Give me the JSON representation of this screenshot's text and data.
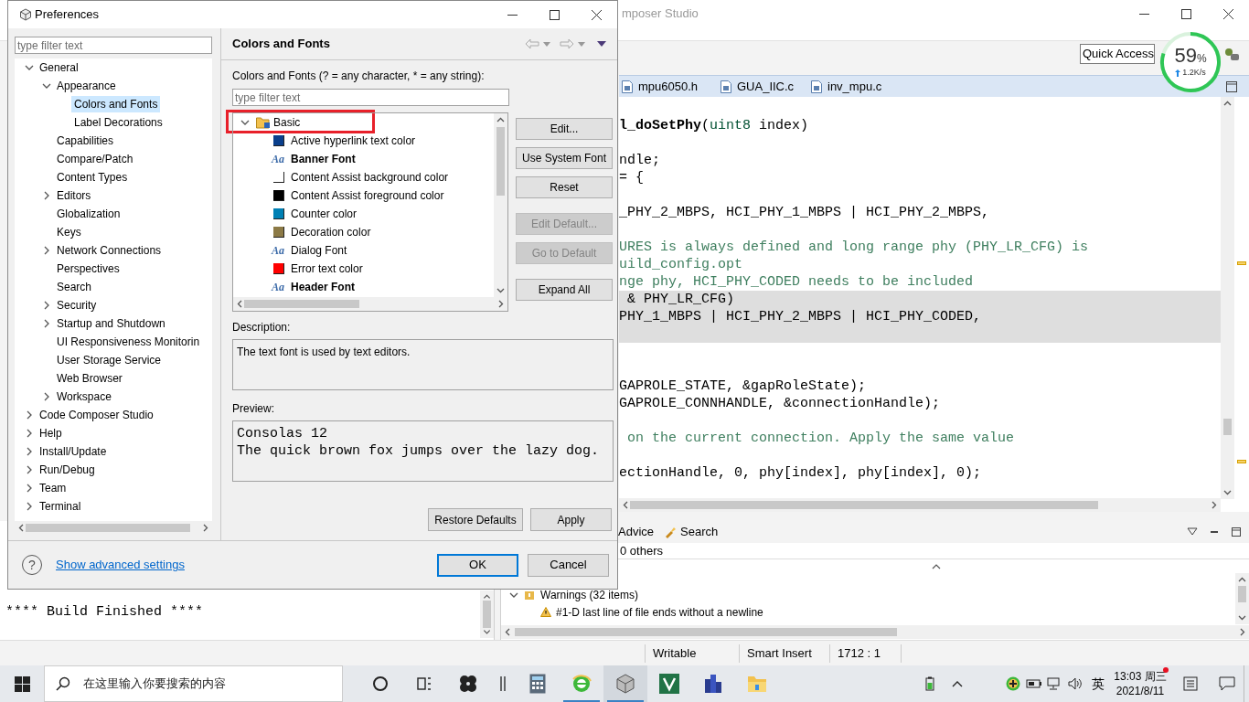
{
  "ide": {
    "title": "mposer Studio",
    "quick_access": "Quick Access",
    "meter": {
      "percent": "59",
      "unit": "%",
      "rate": "1.2K/s"
    },
    "editor_tabs": [
      {
        "label": "mpu6050.h"
      },
      {
        "label": "GUA_IIC.c"
      },
      {
        "label": "inv_mpu.c"
      }
    ],
    "code_lines": [
      {
        "highlighted": false,
        "segments": [
          {
            "kind": "bold",
            "text": "l_doSetPhy"
          },
          {
            "kind": "plain",
            "text": "("
          },
          {
            "kind": "type",
            "text": "uint8"
          },
          {
            "kind": "plain",
            "text": " index)"
          }
        ]
      },
      {
        "highlighted": false
      },
      {
        "highlighted": false,
        "segments": [
          {
            "kind": "plain",
            "text": "ndle;"
          }
        ]
      },
      {
        "highlighted": false,
        "segments": [
          {
            "kind": "plain",
            "text": "= {"
          }
        ]
      },
      {
        "highlighted": false
      },
      {
        "highlighted": false,
        "segments": [
          {
            "kind": "plain",
            "text": "_PHY_2_MBPS, HCI_PHY_1_MBPS | HCI_PHY_2_MBPS,"
          }
        ]
      },
      {
        "highlighted": false
      },
      {
        "highlighted": false,
        "segments": [
          {
            "kind": "comment",
            "text": "URES is always defined and long range phy (PHY_LR_CFG) is"
          }
        ]
      },
      {
        "highlighted": false,
        "segments": [
          {
            "kind": "comment",
            "text": "uild_config.opt"
          }
        ]
      },
      {
        "highlighted": false,
        "segments": [
          {
            "kind": "comment",
            "text": "nge phy, HCI_PHY_CODED needs to be included"
          }
        ]
      },
      {
        "highlighted": true,
        "segments": [
          {
            "kind": "plain",
            "text": " & PHY_LR_CFG)"
          }
        ]
      },
      {
        "highlighted": true,
        "segments": [
          {
            "kind": "plain",
            "text": "PHY_1_MBPS | HCI_PHY_2_MBPS | HCI_PHY_CODED,"
          }
        ]
      },
      {
        "highlighted": true
      },
      {
        "highlighted": false
      },
      {
        "highlighted": false
      },
      {
        "highlighted": false,
        "segments": [
          {
            "kind": "plain",
            "text": "GAPROLE_STATE, &gapRoleState);"
          }
        ]
      },
      {
        "highlighted": false,
        "segments": [
          {
            "kind": "plain",
            "text": "GAPROLE_CONNHANDLE, &connectionHandle);"
          }
        ]
      },
      {
        "highlighted": false
      },
      {
        "highlighted": false,
        "segments": [
          {
            "kind": "comment",
            "text": " on the current connection. Apply the same value"
          }
        ]
      },
      {
        "highlighted": false
      },
      {
        "highlighted": false,
        "segments": [
          {
            "kind": "plain",
            "text": "ectionHandle, 0, phy[index], phy[index], 0);"
          }
        ]
      }
    ],
    "console": {
      "text": "**** Build Finished ****"
    },
    "problems": {
      "tabs": [
        {
          "label": "Advice"
        },
        {
          "label": "Search"
        }
      ],
      "summary": "0 others",
      "groups": [
        {
          "label": "Warnings (32 items)",
          "expanded": true,
          "children": [
            {
              "label": "#1-D last line of file ends without a newline"
            }
          ]
        }
      ]
    },
    "status_bar": [
      "Writable",
      "Smart Insert",
      "1712 : 1"
    ]
  },
  "dialog": {
    "title": "Preferences",
    "filter_placeholder": "type filter text",
    "tree": [
      {
        "label": "General",
        "expanded": true,
        "selected": false,
        "children": [
          {
            "label": "Appearance",
            "expanded": true,
            "selected": false,
            "children": [
              {
                "label": "Colors and Fonts",
                "selected": true
              },
              {
                "label": "Label Decorations",
                "selected": false
              }
            ]
          },
          {
            "label": "Capabilities",
            "selected": false
          },
          {
            "label": "Compare/Patch",
            "selected": false
          },
          {
            "label": "Content Types",
            "selected": false
          },
          {
            "label": "Editors",
            "expanded": false,
            "selected": false
          },
          {
            "label": "Globalization",
            "selected": false
          },
          {
            "label": "Keys",
            "selected": false
          },
          {
            "label": "Network Connections",
            "expanded": false,
            "selected": false
          },
          {
            "label": "Perspectives",
            "selected": false
          },
          {
            "label": "Search",
            "selected": false
          },
          {
            "label": "Security",
            "expanded": false,
            "selected": false
          },
          {
            "label": "Startup and Shutdown",
            "expanded": false,
            "selected": false
          },
          {
            "label": "UI Responsiveness Monitorin",
            "selected": false
          },
          {
            "label": "User Storage Service",
            "selected": false
          },
          {
            "label": "Web Browser",
            "selected": false
          },
          {
            "label": "Workspace",
            "expanded": false,
            "selected": false
          }
        ]
      },
      {
        "label": "Code Composer Studio",
        "expanded": false,
        "selected": false
      },
      {
        "label": "Help",
        "expanded": false,
        "selected": false
      },
      {
        "label": "Install/Update",
        "expanded": false,
        "selected": false
      },
      {
        "label": "Run/Debug",
        "expanded": false,
        "selected": false
      },
      {
        "label": "Team",
        "expanded": false,
        "selected": false
      },
      {
        "label": "Terminal",
        "expanded": false,
        "selected": false
      }
    ],
    "page_title": "Colors and Fonts",
    "filter_label": "Colors and Fonts (? = any character, * = any string):",
    "page_filter_placeholder": "type filter text",
    "items": [
      {
        "label": "Basic",
        "expanded": true,
        "highlighted": true,
        "children": [
          {
            "kind": "color",
            "label": "Active hyperlink text color",
            "color": "#0a3f8c"
          },
          {
            "kind": "font",
            "label": "Banner Font",
            "icon": "Aa",
            "bold": true
          },
          {
            "kind": "color",
            "label": "Content Assist background color",
            "color": "#ffffff"
          },
          {
            "kind": "color",
            "label": "Content Assist foreground color",
            "color": "#000000"
          },
          {
            "kind": "color",
            "label": "Counter color",
            "color": "#0080b4"
          },
          {
            "kind": "color",
            "label": "Decoration color",
            "color": "#8c7a46"
          },
          {
            "kind": "font",
            "label": "Dialog Font",
            "icon": "Aa",
            "bold": false
          },
          {
            "kind": "color",
            "label": "Error text color",
            "color": "#ff0000"
          },
          {
            "kind": "font",
            "label": "Header Font",
            "icon": "Aa",
            "bold": true
          }
        ]
      }
    ],
    "side_buttons": [
      [
        {
          "label": "Edit...",
          "disabled": false
        },
        {
          "label": "Use System Font",
          "disabled": false
        },
        {
          "label": "Reset",
          "disabled": false
        }
      ],
      [
        {
          "label": "Edit Default...",
          "disabled": true
        },
        {
          "label": "Go to Default",
          "disabled": true
        }
      ],
      [
        {
          "label": "Expand All",
          "disabled": false
        }
      ]
    ],
    "description_label": "Description:",
    "description": "The text font is used by text editors.",
    "preview_label": "Preview:",
    "preview_lines": [
      "Consolas 12",
      "The quick brown fox jumps over the lazy dog."
    ],
    "page_buttons": [
      "Restore Defaults",
      "Apply"
    ],
    "help_glyph": "?",
    "help_link": "Show advanced settings",
    "buttons": [
      {
        "label": "OK",
        "default": true
      },
      {
        "label": "Cancel",
        "default": false
      }
    ]
  },
  "taskbar": {
    "search_placeholder": "在这里输入你要搜索的内容",
    "apps": [
      {
        "kind": "cortana",
        "running": false,
        "focused": false
      },
      {
        "kind": "task-view",
        "running": false,
        "focused": false
      },
      {
        "kind": "pinwheel",
        "running": false,
        "focused": false
      },
      {
        "kind": "divider",
        "running": false,
        "focused": false
      },
      {
        "kind": "calculator",
        "running": false,
        "focused": false
      },
      {
        "kind": "browser",
        "running": true,
        "focused": false
      },
      {
        "kind": "cube",
        "running": true,
        "focused": true
      },
      {
        "kind": "v-app",
        "running": false,
        "focused": false
      },
      {
        "kind": "buildings",
        "running": false,
        "focused": false
      },
      {
        "kind": "folder",
        "running": false,
        "focused": false
      }
    ],
    "ime": "英",
    "time": "13:03 周三",
    "date": "2021/8/11",
    "notification_dot": true
  }
}
